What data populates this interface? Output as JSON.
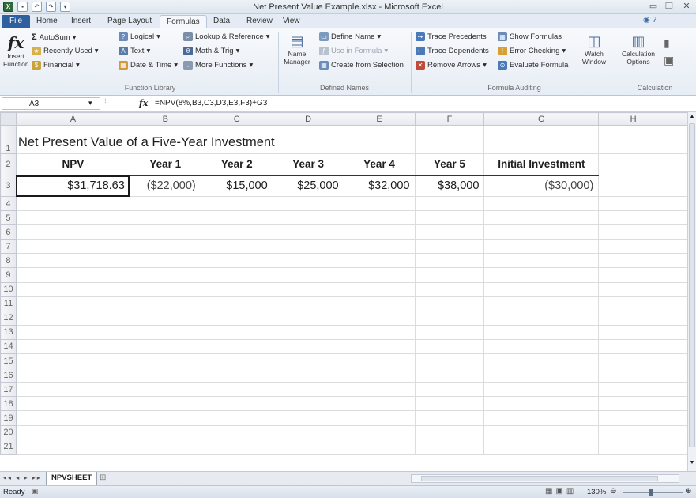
{
  "window": {
    "title": "Net Present Value Example.xlsx - Microsoft Excel"
  },
  "tabs": [
    "File",
    "Home",
    "Insert",
    "Page Layout",
    "Formulas",
    "Data",
    "Review",
    "View"
  ],
  "active_tab": "Formulas",
  "ribbon": {
    "function_library": {
      "insert_function": "Insert\nFunction",
      "autosum": "AutoSum",
      "recently_used": "Recently Used",
      "financial": "Financial",
      "logical": "Logical",
      "text": "Text",
      "date_time": "Date & Time",
      "lookup_reference": "Lookup & Reference",
      "math_trig": "Math & Trig",
      "more_functions": "More Functions",
      "group_label": "Function Library"
    },
    "defined_names": {
      "name_manager": "Name\nManager",
      "define_name": "Define Name",
      "use_in_formula": "Use in Formula",
      "create_from_selection": "Create from Selection",
      "group_label": "Defined Names"
    },
    "formula_auditing": {
      "trace_precedents": "Trace Precedents",
      "trace_dependents": "Trace Dependents",
      "remove_arrows": "Remove Arrows",
      "show_formulas": "Show Formulas",
      "error_checking": "Error Checking",
      "evaluate_formula": "Evaluate Formula",
      "watch_window": "Watch\nWindow",
      "group_label": "Formula Auditing"
    },
    "calculation": {
      "calculation_options": "Calculation\nOptions",
      "group_label": "Calculation"
    }
  },
  "formula_bar": {
    "name_box": "A3",
    "fx": "fx",
    "formula": "=NPV(8%,B3,C3,D3,E3,F3)+G3"
  },
  "columns": [
    "A",
    "B",
    "C",
    "D",
    "E",
    "F",
    "G",
    "H"
  ],
  "rows": [
    "1",
    "2",
    "3",
    "4",
    "5",
    "6",
    "7",
    "8",
    "9",
    "10",
    "11",
    "12",
    "13",
    "14",
    "15",
    "16",
    "17",
    "18",
    "19",
    "20",
    "21"
  ],
  "sheet": {
    "title": "Net Present Value of a Five-Year Investment",
    "headers": [
      "NPV",
      "Year 1",
      "Year 2",
      "Year 3",
      "Year 4",
      "Year 5",
      "Initial Investment"
    ],
    "values": [
      "$31,718.63",
      "($22,000)",
      "$15,000",
      "$25,000",
      "$32,000",
      "$38,000",
      "($30,000)"
    ]
  },
  "sheet_tabs": [
    "NPVSHEET"
  ],
  "status": {
    "ready": "Ready",
    "zoom": "130%"
  },
  "colors": {
    "file_tab": "#2e5f9e",
    "excel_green": "#2f6a3a"
  }
}
